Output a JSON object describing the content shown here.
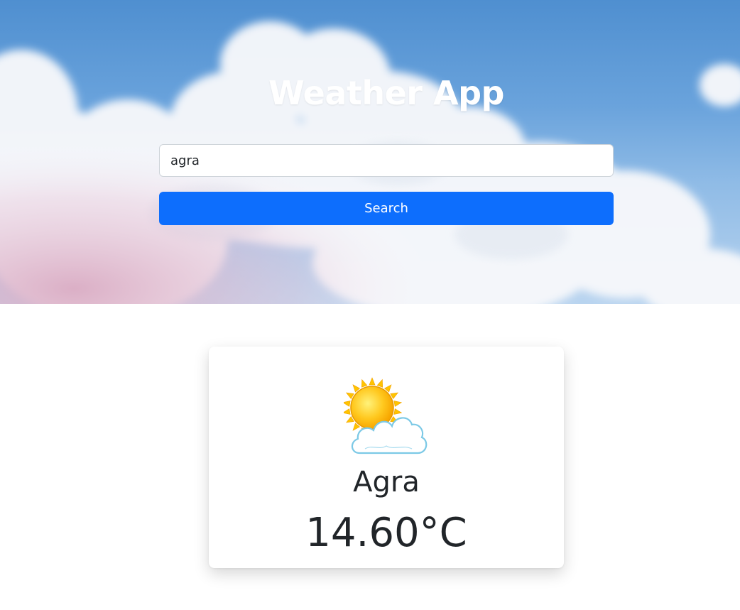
{
  "header": {
    "title": "Weather App"
  },
  "search": {
    "value": "agra",
    "button_label": "Search"
  },
  "weather": {
    "city": "Agra",
    "temperature": "14.60°C",
    "icon": "partly-cloudy-icon"
  },
  "colors": {
    "button": "#0d6efd",
    "text": "#212529",
    "title": "#ffffff"
  }
}
